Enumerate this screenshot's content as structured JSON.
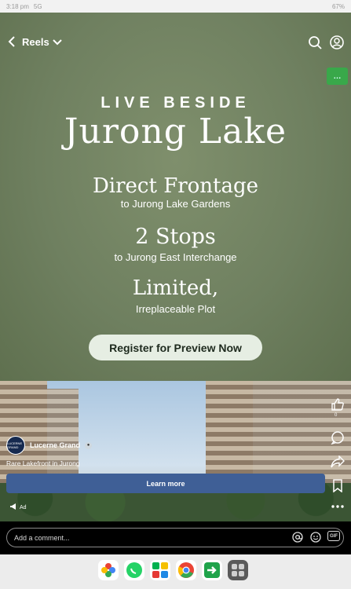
{
  "status": {
    "time": "3:18 pm",
    "network": "5G",
    "battery": "67%"
  },
  "header": {
    "title": "Reels"
  },
  "ad": {
    "line1": "LIVE BESIDE",
    "line2": "Jurong Lake",
    "direct": "Direct Frontage",
    "direct_sub": "to Jurong Lake Gardens",
    "stops": "2 Stops",
    "stops_sub": "to Jurong East Interchange",
    "limited": "Limited,",
    "limited_sub": "Irreplaceable Plot",
    "cta": "Register for Preview Now",
    "green_tag": "…"
  },
  "post": {
    "page_name": "Lucerne Grand",
    "avatar_text": "LUCERNE GRAND",
    "caption": "Rare Lakefront in Jurong",
    "learn_more": "Learn more",
    "ad_label": "Ad",
    "like_count": "0"
  },
  "comment": {
    "placeholder": "Add a comment..."
  },
  "colors": {
    "hero_bg": "#6f8060",
    "button_blue": "#3f5f96",
    "accent_green": "#39a84a"
  },
  "icons": [
    "back-icon",
    "chevron-down-icon",
    "search-icon",
    "profile-icon",
    "like-icon",
    "comment-icon",
    "share-icon",
    "bookmark-icon",
    "more-icon",
    "at-icon",
    "emoji-icon",
    "gif-icon"
  ],
  "dock": {
    "apps": [
      "Photos",
      "WhatsApp",
      "Grab",
      "Chrome",
      "Forward",
      "App drawer"
    ]
  }
}
